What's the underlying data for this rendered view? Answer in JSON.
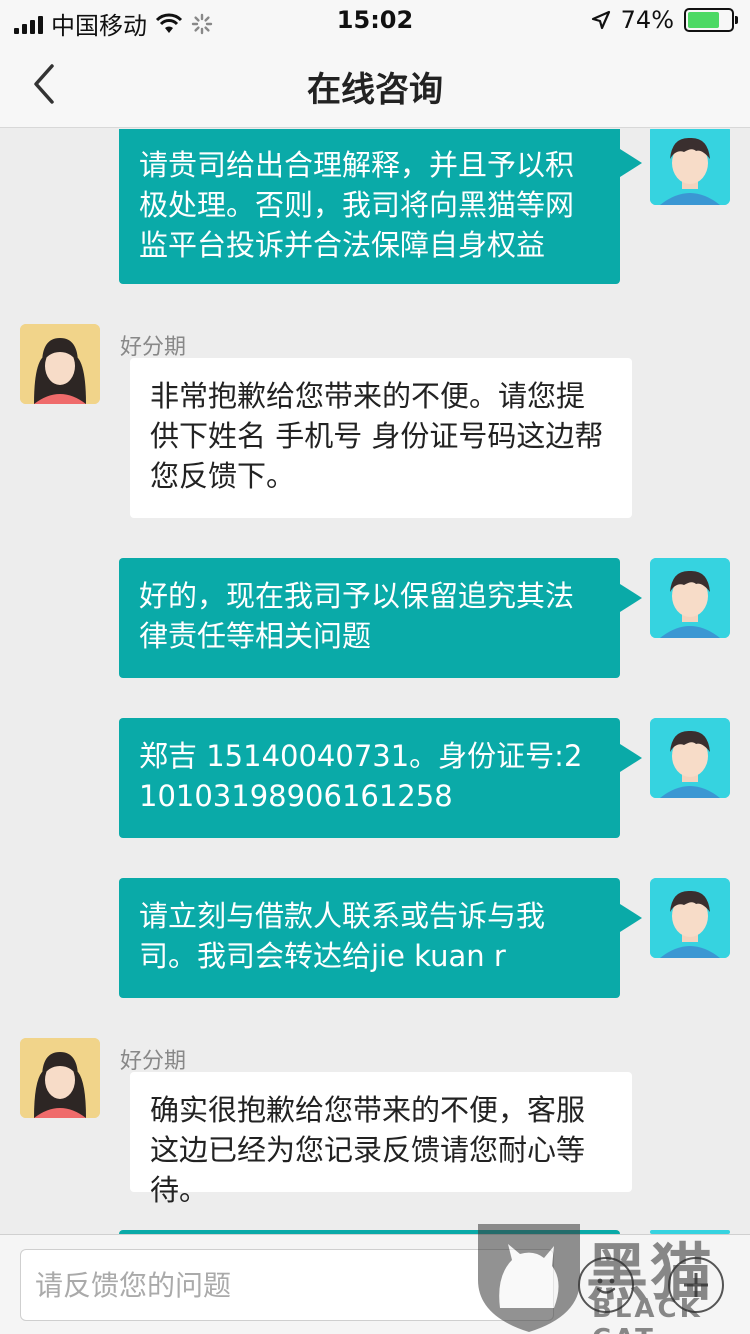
{
  "status_bar": {
    "carrier": "中国移动",
    "time": "15:02",
    "battery_percent": "74%",
    "battery_level": 0.74,
    "icons": [
      "signal-icon",
      "wifi-icon",
      "loading-icon",
      "location-arrow-icon",
      "battery-icon"
    ]
  },
  "nav": {
    "title": "在线咨询",
    "back_icon": "chevron-left-icon"
  },
  "messages": [
    {
      "side": "right",
      "text": "请贵司给出合理解释，并且予以积极处理。否则，我司将向黑猫等网监平台投诉并合法保障自身权益"
    },
    {
      "side": "left",
      "sender": "好分期",
      "text": "非常抱歉给您带来的不便。请您提供下姓名 手机号 身份证号码这边帮您反馈下。"
    },
    {
      "side": "right",
      "text": "好的，现在我司予以保留追究其法律责任等相关问题"
    },
    {
      "side": "right",
      "text": "郑吉 15140040731。身份证号:210103198906161258"
    },
    {
      "side": "right",
      "text": "请立刻与借款人联系或告诉与我司。我司会转达给jie kuan r"
    },
    {
      "side": "left",
      "sender": "好分期",
      "text": "确实很抱歉给您带来的不便，客服这边已经为您记录反馈请您耐心等待。"
    }
  ],
  "input": {
    "placeholder": "请反馈您的问题",
    "value": ""
  },
  "watermark": {
    "cn": "黑猫",
    "en": "BLACK CAT"
  },
  "colors": {
    "outgoing_bubble": "#0aaaa8",
    "incoming_bubble": "#ffffff",
    "background": "#ededed"
  }
}
